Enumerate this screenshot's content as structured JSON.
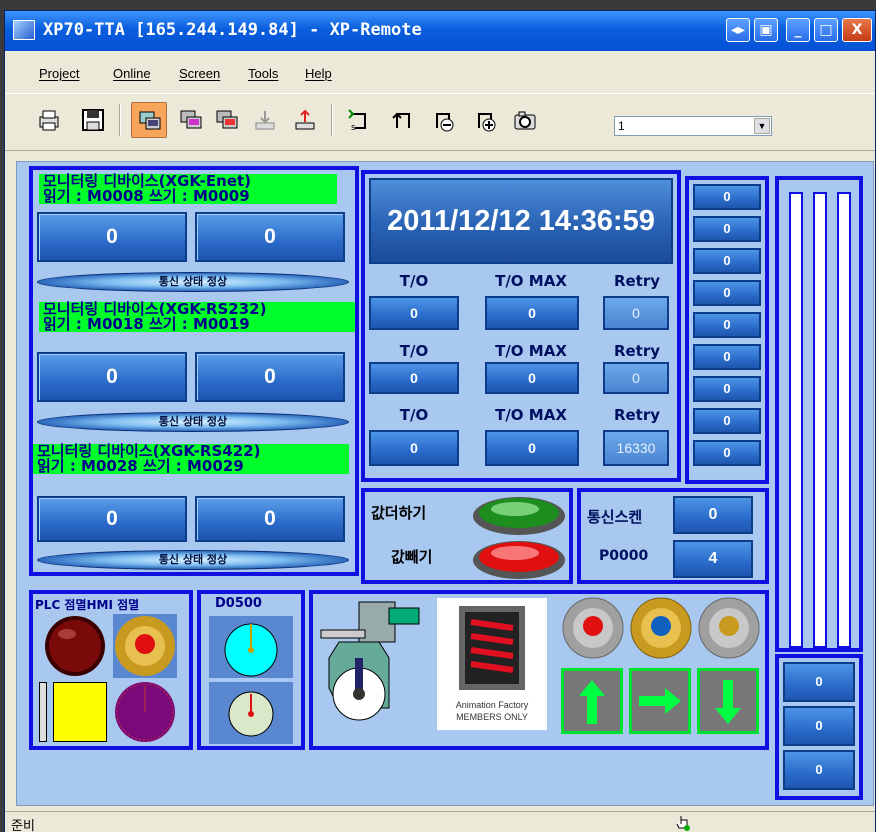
{
  "window": {
    "title": "XP70-TTA [165.244.149.84] - XP-Remote",
    "title_buttons": [
      "◂▸",
      "▣",
      "_",
      "□",
      "X"
    ]
  },
  "menu": {
    "items": [
      "Project",
      "Online",
      "Screen",
      "Tools",
      "Help"
    ]
  },
  "toolbar": {
    "icons": [
      "print-icon",
      "save-icon",
      "monitor-active-icon",
      "monitor-icon",
      "monitor-color-icon",
      "download-icon",
      "upload-icon",
      "screen-first-icon",
      "screen-prev-icon",
      "screen-minus-icon",
      "screen-plus-icon",
      "camera-icon"
    ],
    "screen_select_value": "1"
  },
  "devices": [
    {
      "title": "모니터링 디바이스(XGK-Enet)",
      "rw": "읽기 : M0008    쓰기 : M0009",
      "read_value": "0",
      "write_value": "0",
      "status": "통신 상태 정상"
    },
    {
      "title": "모니터링 디바이스(XGK-RS232)",
      "rw": "읽기 : M0018    쓰기 : M0019",
      "read_value": "0",
      "write_value": "0",
      "status": "통신 상태 정상"
    },
    {
      "title": "모니터링 디바이스(XGK-RS422)",
      "rw": "읽기 : M0028    쓰기 : M0029",
      "read_value": "0",
      "write_value": "0",
      "status": "통신 상태 정상"
    }
  ],
  "datetime": "2011/12/12 14:36:59",
  "timeouts": {
    "headers": [
      "T/O",
      "T/O MAX",
      "Retry"
    ],
    "rows": [
      [
        "0",
        "0",
        "0"
      ],
      [
        "0",
        "0",
        "0"
      ],
      [
        "0",
        "0",
        "16330"
      ]
    ]
  },
  "value_column": [
    "0",
    "0",
    "0",
    "0",
    "0",
    "0",
    "0",
    "0",
    "0"
  ],
  "value_column_bottom": [
    "0",
    "0",
    "0"
  ],
  "actions": {
    "add_label": "값더하기",
    "sub_label": "값빼기"
  },
  "comm": {
    "scan_label": "통신스켄",
    "scan_value": "0",
    "addr_label": "P0000",
    "addr_value": "4"
  },
  "lamps": {
    "title": "PLC 점멸HMI 점멸",
    "colors": {
      "red": "#6B0000",
      "gold": "#C89A20",
      "yellow": "#FFFF00",
      "purple": "#7A0A7A"
    }
  },
  "gauge": {
    "title": "D0500"
  },
  "animation": {
    "caption_line1": "Animation Factory",
    "caption_line2": "MEMBERS ONLY"
  },
  "status": {
    "text": "준비"
  },
  "colors": {
    "panel_border": "#1010E0",
    "panel_bg": "#A8C8F0",
    "label_green": "#00FF2A",
    "title_blue": "#0552D6"
  }
}
